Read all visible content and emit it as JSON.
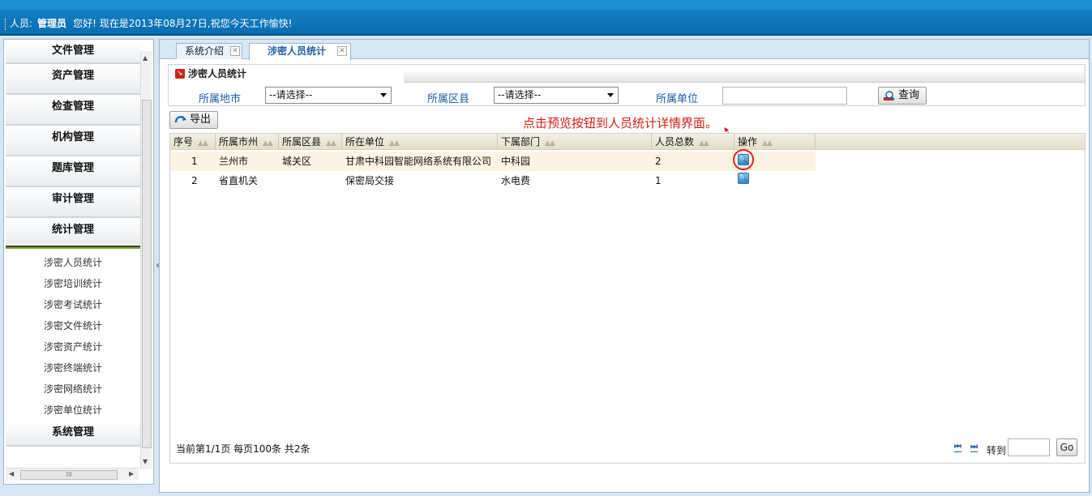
{
  "header": {
    "user_label": "人员:",
    "user_name": "管理员",
    "greeting": "您好!  现在是2013年08月27日,祝您今天工作愉快!"
  },
  "sidebar": {
    "menus": [
      {
        "label": "文件管理"
      },
      {
        "label": "资产管理"
      },
      {
        "label": "检查管理"
      },
      {
        "label": "机构管理"
      },
      {
        "label": "题库管理"
      },
      {
        "label": "审计管理"
      },
      {
        "label": "统计管理"
      }
    ],
    "submenu": [
      {
        "label": "涉密人员统计"
      },
      {
        "label": "涉密培训统计"
      },
      {
        "label": "涉密考试统计"
      },
      {
        "label": "涉密文件统计"
      },
      {
        "label": "涉密资产统计"
      },
      {
        "label": "涉密终端统计"
      },
      {
        "label": "涉密网络统计"
      },
      {
        "label": "涉密单位统计"
      }
    ],
    "last_menu": "系统管理",
    "collapse": "«"
  },
  "tabs": [
    {
      "label": "系统介绍"
    },
    {
      "label": "涉密人员统计"
    }
  ],
  "panel": {
    "title": "涉密人员统计",
    "city_label": "所属地市",
    "city_value": "--请选择--",
    "district_label": "所属区县",
    "district_value": "--请选择--",
    "unit_label": "所属单位",
    "unit_value": "",
    "query_label": "查询"
  },
  "toolbar": {
    "export_label": "导出"
  },
  "annotation": "点击预览按钮到人员统计详情界面。",
  "table": {
    "columns": [
      "序号",
      "所属市州",
      "所属区县",
      "所在单位",
      "下属部门",
      "人员总数",
      "操作"
    ],
    "rows": [
      {
        "no": "1",
        "city": "兰州市",
        "district": "城关区",
        "unit": "甘肃中科园智能网络系统有限公司",
        "dept": "中科园",
        "total": "2"
      },
      {
        "no": "2",
        "city": "省直机关",
        "district": "",
        "unit": "保密局交接",
        "dept": "水电费",
        "total": "1"
      }
    ]
  },
  "pager": {
    "info": "当前第1/1页  每页100条  共2条",
    "first": "⏮",
    "last": "⏭",
    "goto_label": "转到",
    "goto_value": "",
    "go_label": "Go"
  },
  "colors": {
    "topbar": "#0a6db0",
    "annotation": "#d41c14",
    "link": "#1b5ea8"
  }
}
